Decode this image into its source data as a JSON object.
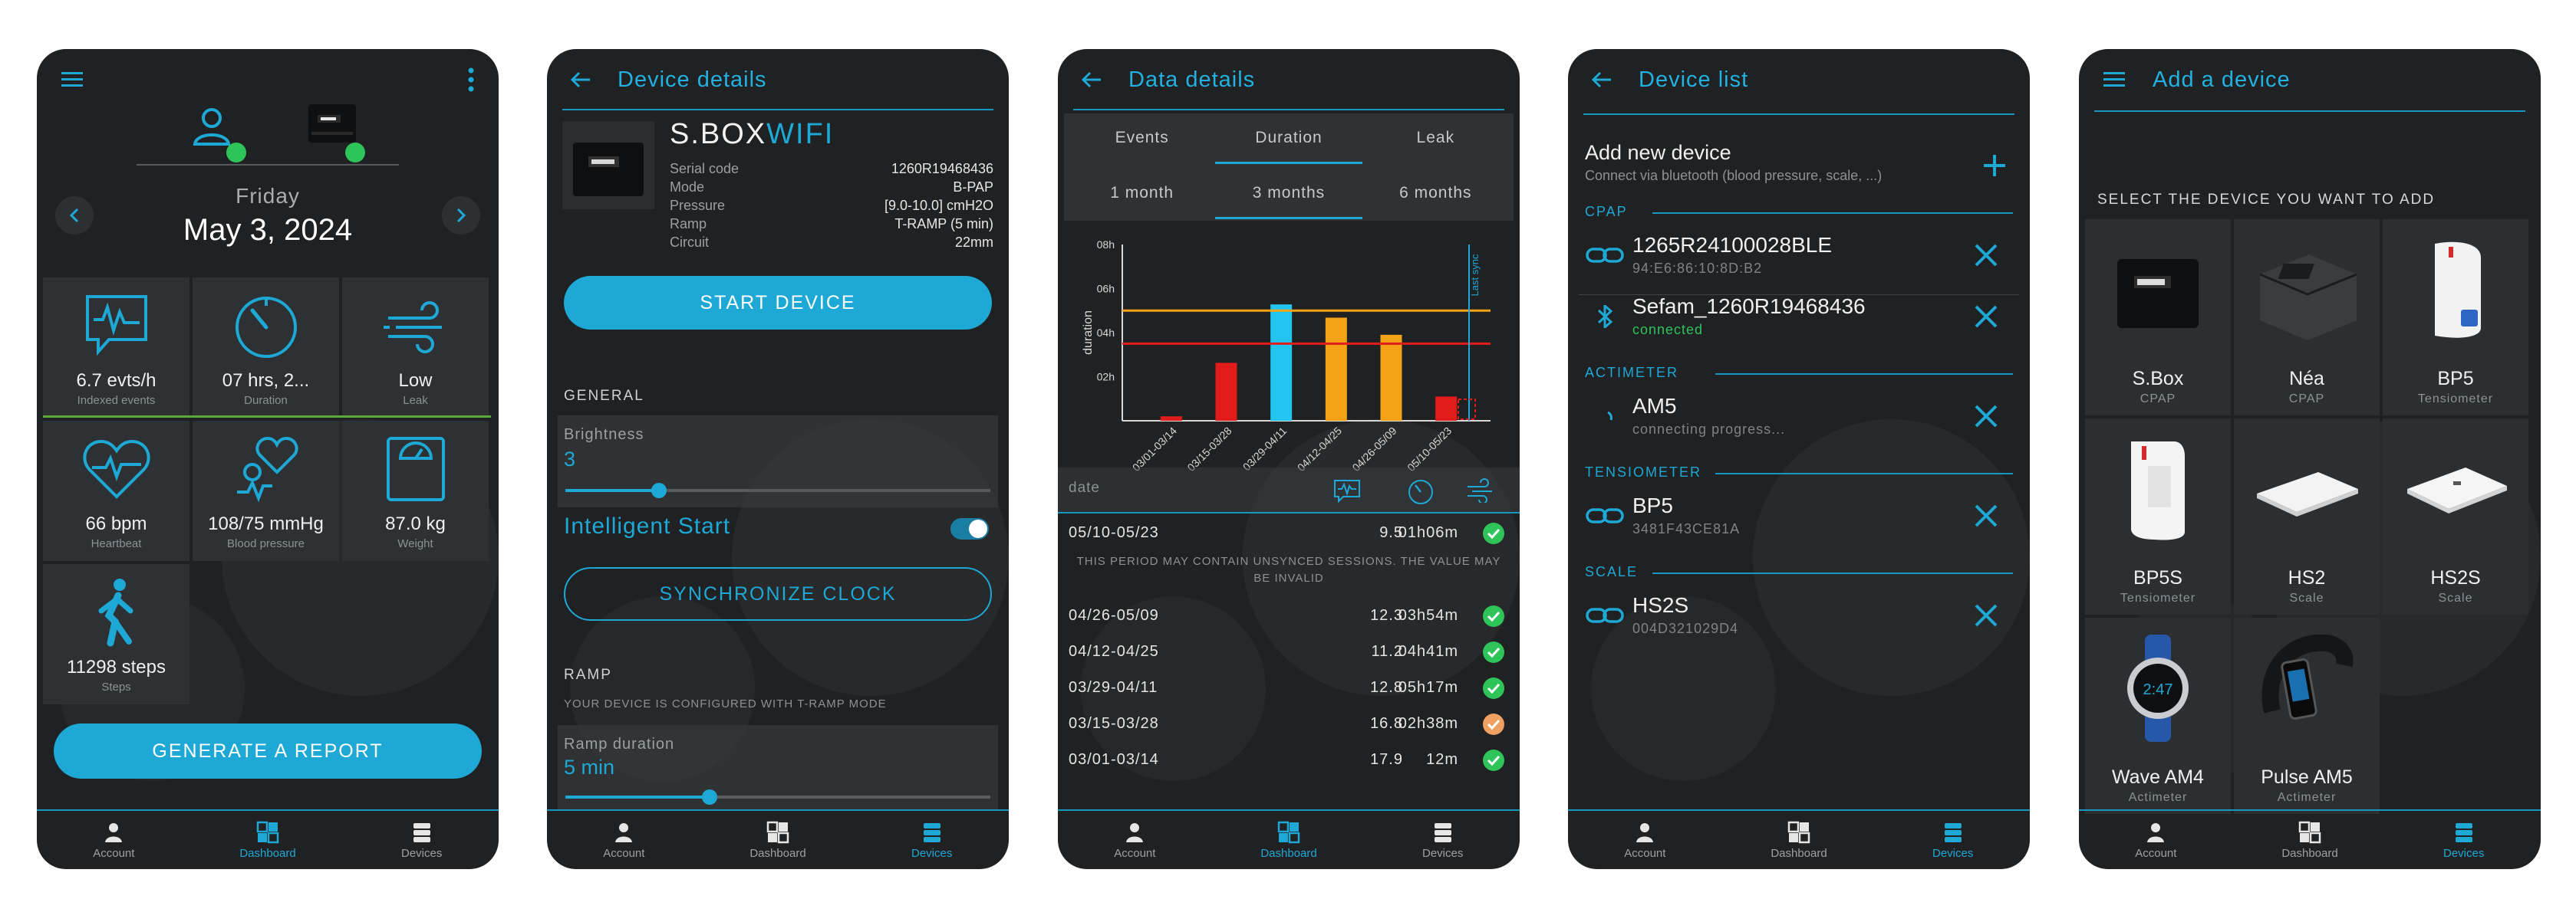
{
  "nav": {
    "account": "Account",
    "dashboard": "Dashboard",
    "devices": "Devices"
  },
  "screen1": {
    "day": "Friday",
    "date": "May 3, 2024",
    "tiles": [
      {
        "value": "6.7 evts/h",
        "label": "Indexed events",
        "icon": "waveform-chat-icon"
      },
      {
        "value": "07 hrs, 2...",
        "label": "Duration",
        "icon": "gauge-icon"
      },
      {
        "value": "Low",
        "label": "Leak",
        "icon": "wind-icon"
      },
      {
        "value": "66 bpm",
        "label": "Heartbeat",
        "icon": "heart-pulse-icon"
      },
      {
        "value": "108/75 mmHg",
        "label": "Blood pressure",
        "icon": "blood-pressure-icon"
      },
      {
        "value": "87.0 kg",
        "label": "Weight",
        "icon": "scale-icon"
      },
      {
        "value": "11298 steps",
        "label": "Steps",
        "icon": "walking-icon"
      }
    ],
    "report_button": "GENERATE A REPORT",
    "colors": {
      "accent": "#1ea8d6",
      "status_ok": "#2ec45a"
    }
  },
  "screen2": {
    "title": "Device details",
    "device_name": "S.BOX",
    "device_name_accent": "WIFI",
    "specs": [
      {
        "key": "Serial code",
        "value": "1260R19468436"
      },
      {
        "key": "Mode",
        "value": "B-PAP"
      },
      {
        "key": "Pressure",
        "value": "[9.0-10.0] cmH2O"
      },
      {
        "key": "Ramp",
        "value": "T-RAMP (5 min)"
      },
      {
        "key": "Circuit",
        "value": "22mm"
      }
    ],
    "start_button": "START DEVICE",
    "general_label": "GENERAL",
    "brightness_label": "Brightness",
    "brightness_value": "3",
    "brightness_fraction": 0.22,
    "intelligent_start_label": "Intelligent Start",
    "intelligent_start_on": true,
    "sync_button": "SYNCHRONIZE CLOCK",
    "ramp_label": "RAMP",
    "ramp_note": "YOUR DEVICE IS CONFIGURED WITH T-RAMP MODE",
    "ramp_duration_label": "Ramp duration",
    "ramp_duration_value": "5 min",
    "ramp_fraction": 0.34
  },
  "screen3": {
    "title": "Data details",
    "tabs": [
      "Events",
      "Duration",
      "Leak"
    ],
    "active_tab": 1,
    "ranges": [
      "1 month",
      "3 months",
      "6 months"
    ],
    "active_range": 1,
    "table_header_date": "date",
    "warning": "THIS PERIOD MAY CONTAIN UNSYNCED SESSIONS. THE VALUE MAY BE INVALID",
    "rows": [
      {
        "period": "05/10-05/23",
        "events": "9.5",
        "duration": "01h06m",
        "status": "ok"
      },
      {
        "period": "04/26-05/09",
        "events": "12.3",
        "duration": "03h54m",
        "status": "ok"
      },
      {
        "period": "04/12-04/25",
        "events": "11.2",
        "duration": "04h41m",
        "status": "ok"
      },
      {
        "period": "03/29-04/11",
        "events": "12.8",
        "duration": "05h17m",
        "status": "ok"
      },
      {
        "period": "03/15-03/28",
        "events": "16.8",
        "duration": "02h38m",
        "status": "warn"
      },
      {
        "period": "03/01-03/14",
        "events": "17.9",
        "duration": "12m",
        "status": "ok"
      }
    ]
  },
  "chart_data": {
    "type": "bar",
    "categories": [
      "03/01-03/14",
      "03/15-03/28",
      "03/29-04/11",
      "04/12-04/25",
      "04/26-05/09",
      "05/10-05/23"
    ],
    "values": [
      0.2,
      2.63,
      5.28,
      4.68,
      3.9,
      1.1
    ],
    "colors": [
      "#e21b1b",
      "#e21b1b",
      "#22c4f0",
      "#f5a316",
      "#f5a316",
      "#e21b1b"
    ],
    "ylabel": "duration",
    "ytick_labels": [
      "02h",
      "04h",
      "06h",
      "08h"
    ],
    "ylim": [
      0,
      8
    ],
    "reference_lines": [
      {
        "value": 5,
        "color": "#f5a316"
      },
      {
        "value": 3.5,
        "color": "#e21b1b"
      }
    ],
    "annotation": "Last sync",
    "grid": false
  },
  "screen4": {
    "title": "Device list",
    "add_title": "Add new device",
    "add_subtitle": "Connect via bluetooth (blood pressure, scale, ...)",
    "categories": {
      "cpap": "CPAP",
      "actimeter": "ACTIMETER",
      "tensiometer": "TENSIOMETER",
      "scale": "SCALE"
    },
    "devices": [
      {
        "name": "1265R24100028BLE",
        "sub": "94:E6:86:10:8D:B2",
        "icon": "link-icon"
      },
      {
        "name": "Sefam_1260R19468436",
        "sub": "connected",
        "icon": "bluetooth-icon"
      },
      {
        "name": "AM5",
        "sub": "connecting progress...",
        "icon": "spinner-icon"
      },
      {
        "name": "BP5",
        "sub": "3481F43CE81A",
        "icon": "link-icon"
      },
      {
        "name": "HS2S",
        "sub": "004D321029D4",
        "icon": "link-icon"
      }
    ],
    "colors": {
      "connected": "#2ec45a"
    }
  },
  "screen5": {
    "title": "Add a device",
    "select_label": "SELECT THE DEVICE YOU WANT TO ADD",
    "devices": [
      {
        "name": "S.Box",
        "type": "CPAP"
      },
      {
        "name": "Néa",
        "type": "CPAP"
      },
      {
        "name": "BP5",
        "type": "Tensiometer"
      },
      {
        "name": "BP5S",
        "type": "Tensiometer"
      },
      {
        "name": "HS2",
        "type": "Scale"
      },
      {
        "name": "HS2S",
        "type": "Scale"
      },
      {
        "name": "Wave AM4",
        "type": "Actimeter"
      },
      {
        "name": "Pulse AM5",
        "type": "Actimeter"
      }
    ]
  }
}
